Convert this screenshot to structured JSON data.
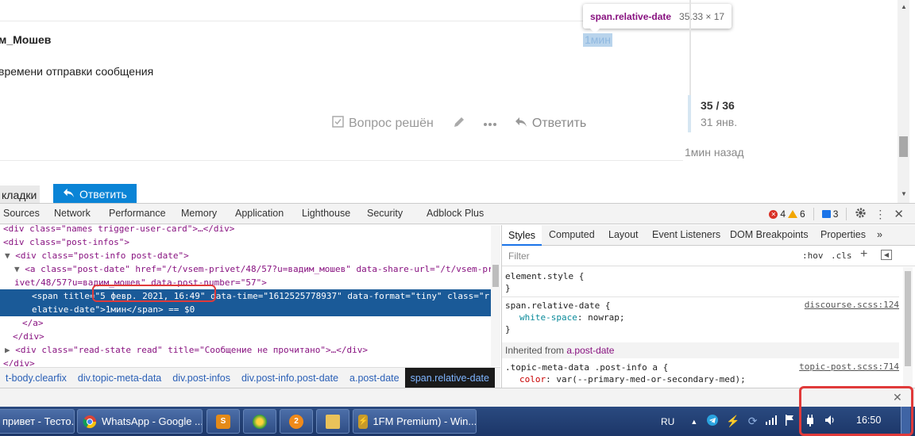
{
  "page": {
    "username": "м_Мошев",
    "post_text": "времени отправки сообщения",
    "relative_date": "1мин",
    "tooltip": {
      "selector": "span.relative-date",
      "dimensions": "35.33 × 17"
    },
    "actions": {
      "solved_label": "Вопрос решён",
      "reply_label": "Ответить"
    },
    "timeline": {
      "count": "35 / 36",
      "date": "31 янв.",
      "ago": "1мин назад"
    },
    "bookmarks_label": "кладки",
    "reply_button_label": "Ответить"
  },
  "devtools": {
    "tabs": [
      "Sources",
      "Network",
      "Performance",
      "Memory",
      "Application",
      "Lighthouse",
      "Security",
      "Adblock Plus"
    ],
    "errors": "4",
    "warnings": "6",
    "messages": "3",
    "dom_lines": [
      [
        "",
        "<div class=\"names trigger-user-card\">…</div>"
      ],
      [
        "",
        "<div class=\"post-infos\">"
      ],
      [
        "▼",
        "<div class=\"post-info post-date\">"
      ],
      [
        "▼",
        "<a class=\"post-date\" href=\"/t/vsem-privet/48/57?u=вадим_мошев\" data-share-url=\"/t/vsem-pr"
      ],
      [
        "",
        "ivet/48/57?u=вадим_мошев\" data-post-number=\"57\">"
      ],
      [
        "",
        "<span title=\"5 февр. 2021, 16:49\" data-time=\"1612525778937\" data-format=\"tiny\" class=\"r"
      ],
      [
        "",
        "elative-date\">1мин</span> == $0"
      ],
      [
        "",
        "</a>"
      ],
      [
        "",
        "</div>"
      ],
      [
        "▶",
        "<div class=\"read-state read\" title=\"Сообщение не прочитано\">…</div>"
      ],
      [
        "",
        "</div>"
      ]
    ],
    "breadcrumbs": [
      "t-body.clearfix",
      "div.topic-meta-data",
      "div.post-infos",
      "div.post-info.post-date",
      "a.post-date",
      "span.relative-date"
    ],
    "styles_tabs": [
      "Styles",
      "Computed",
      "Layout",
      "Event Listeners",
      "DOM Breakpoints",
      "Properties",
      "»"
    ],
    "filter_placeholder": "Filter",
    "hov_label": ":hov",
    "cls_label": ".cls",
    "element_style": "element.style {",
    "close_brace": "}",
    "rule1": {
      "selector": "span.relative-date {",
      "source": "discourse.scss:124",
      "prop": "white-space",
      "value": "nowrap;"
    },
    "inherited": {
      "prefix": "Inherited from",
      "tag": "a.post-date"
    },
    "rule2": {
      "selector": ".topic-meta-data .post-info a {",
      "source": "topic-post.scss:714",
      "prop": "color",
      "value": "var(--primary-med-or-secondary-med);"
    }
  },
  "taskbar": {
    "buttons": [
      {
        "label": "привет - Тесто...",
        "icon": "folder-icon"
      },
      {
        "label": "WhatsApp - Google ...",
        "icon": "chrome-icon"
      },
      {
        "label": "",
        "icon": "app-s-icon"
      },
      {
        "label": "",
        "icon": "green-orb-icon"
      },
      {
        "label": "",
        "icon": "orange-2-icon"
      },
      {
        "label": "",
        "icon": "explorer-icon"
      },
      {
        "label": "1FM Premium) - Win...",
        "icon": "winamp-icon"
      }
    ],
    "lang": "RU",
    "clock": "16:50"
  },
  "colors": {
    "accent": "#0a84d6",
    "highlight": "#e03a3a",
    "taskbar": "#1c3668"
  }
}
